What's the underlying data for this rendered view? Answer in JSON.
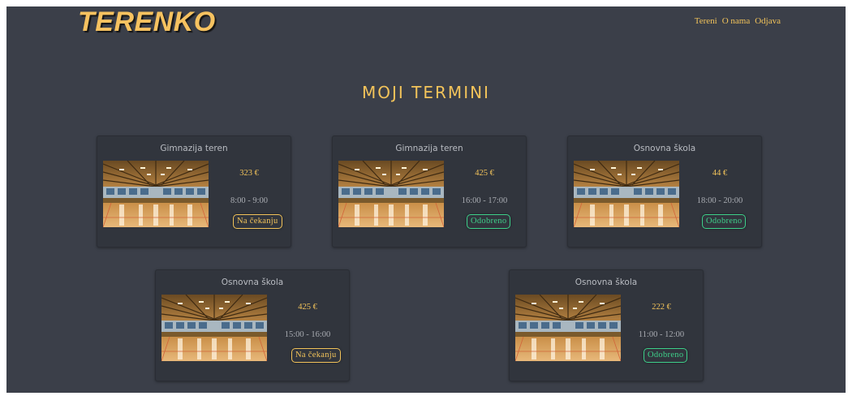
{
  "header": {
    "logo": "TERENKO",
    "nav": [
      {
        "label": "Tereni"
      },
      {
        "label": "O nama"
      },
      {
        "label": "Odjava"
      }
    ]
  },
  "page": {
    "title": "MOJI TERMINI"
  },
  "cards": [
    {
      "title": "Gimnazija teren",
      "price": "323 €",
      "time": "8:00 - 9:00",
      "status": "Na čekanju",
      "status_type": "pending"
    },
    {
      "title": "Gimnazija teren",
      "price": "425 €",
      "time": "16:00 - 17:00",
      "status": "Odobreno",
      "status_type": "approved"
    },
    {
      "title": "Osnovna škola",
      "price": "44 €",
      "time": "18:00 - 20:00",
      "status": "Odobreno",
      "status_type": "approved"
    },
    {
      "title": "Osnovna škola",
      "price": "425 €",
      "time": "15:00 - 16:00",
      "status": "Na čekanju",
      "status_type": "pending"
    },
    {
      "title": "Osnovna škola",
      "price": "222 €",
      "time": "11:00 - 12:00",
      "status": "Odobreno",
      "status_type": "approved"
    }
  ],
  "colors": {
    "background": "#3b3f49",
    "card": "#31353d",
    "accent": "#f2c35a",
    "approved": "#3ed08a"
  }
}
